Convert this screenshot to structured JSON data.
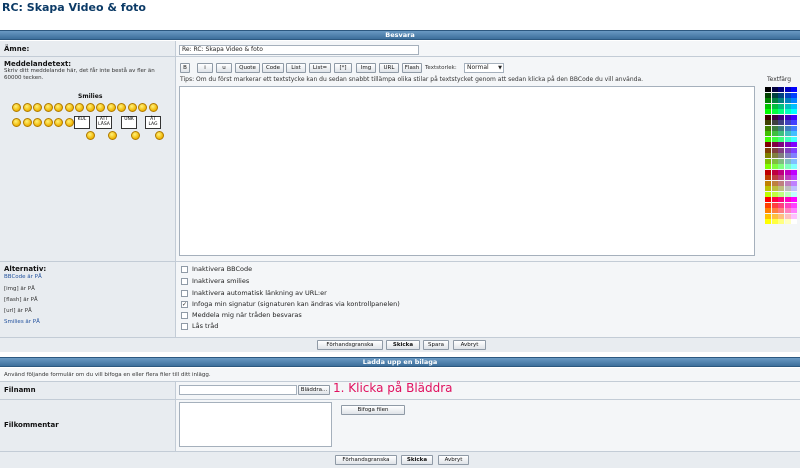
{
  "page": {
    "title": "RC: Skapa Video & foto"
  },
  "reply": {
    "header": "Besvara",
    "subject_label": "Ämne:",
    "subject_value": "Re: RC: Skapa Video & foto",
    "message_label": "Meddelandetext:",
    "message_hint": "Skriv ditt meddelande här, det får inte bestå av fler än 60000 tecken.",
    "smilies_label": "Smilies",
    "tip": "Tips: Om du först markerar ett textstycke kan du sedan snabbt tillämpa olika stilar på textstycket genom att sedan klicka på den BBCode du vill använda.",
    "font_size_label": "Textstorlek:",
    "font_size_value": "Normal",
    "text_color_label": "Textfärg",
    "toolbar": [
      "B",
      "i",
      "u",
      "Quote",
      "Code",
      "List",
      "List=",
      "[*]",
      "Img",
      "URL",
      "Flash"
    ],
    "signs": [
      "KUL",
      "ATT LÄSA",
      "UNK",
      "ÅT LAG"
    ],
    "options_label": "Alternativ:",
    "status_lines": [
      "BBCode är PÅ",
      "[img] är PÅ",
      "[flash] är PÅ",
      "[url] är PÅ",
      "Smilies är PÅ"
    ],
    "options": [
      {
        "label": "Inaktivera BBCode",
        "checked": false
      },
      {
        "label": "Inaktivera smilies",
        "checked": false
      },
      {
        "label": "Inaktivera automatisk länkning av URL:er",
        "checked": false
      },
      {
        "label": "Infoga min signatur (signaturen kan ändras via kontrollpanelen)",
        "checked": true
      },
      {
        "label": "Meddela mig när tråden besvaras",
        "checked": false
      },
      {
        "label": "Lås tråd",
        "checked": false
      }
    ],
    "preview_label": "Förhandsgranska",
    "submit_label": "Skicka",
    "save_label": "Spara",
    "cancel_label": "Avbryt"
  },
  "upload": {
    "header": "Ladda upp en bilaga",
    "description": "Använd följande formulär om du vill bifoga en eller flera filer till ditt inlägg.",
    "filename_label": "Filnamn",
    "browse_label": "Bläddra...",
    "annotation": "1. Klicka på Bläddra",
    "comment_label": "Filkommentar",
    "attach_label": "Bifoga filen",
    "preview_label": "Förhandsgranska",
    "submit_label": "Skicka",
    "cancel_label": "Avbryt"
  },
  "colors": {
    "header_bar": "#3d6f9c",
    "title": "#0b3a66",
    "annotation": "#e0115f"
  }
}
